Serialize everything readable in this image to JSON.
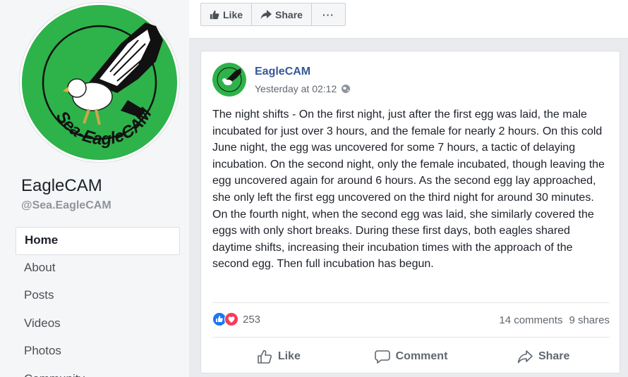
{
  "page": {
    "name": "EagleCAM",
    "handle": "@Sea.EagleCAM",
    "logo_text": "Sea-EagleCAM",
    "logo_color": "#2eb24a"
  },
  "nav": {
    "items": [
      {
        "label": "Home",
        "active": true
      },
      {
        "label": "About"
      },
      {
        "label": "Posts"
      },
      {
        "label": "Videos"
      },
      {
        "label": "Photos"
      },
      {
        "label": "Community"
      }
    ]
  },
  "topbar": {
    "like_label": "Like",
    "like_icon": "thumbs-up-icon",
    "share_label": "Share",
    "share_icon": "share-arrow-icon",
    "more_label": "···"
  },
  "post": {
    "author": "EagleCAM",
    "timestamp": "Yesterday at 02:12",
    "audience_icon": "globe-icon",
    "text_lead": "The night shifts - ",
    "text_body": "On the first night, just after the first egg was laid, the male incubated for just over 3 hours, and the female for nearly 2 hours. On this cold June night, the egg was uncovered for some 7 hours, a tactic of delaying incubation. On the second night, only the female incubated, though leaving the egg uncovered again for around 6 hours. As the second egg lay approached, she only left the first egg uncovered on the third night for around 30 minutes. On the fourth night, when the second egg was laid, she similarly covered the eggs with only short breaks. During these first days, both eagles shared daytime shifts, increasing their incubation times with the approach of the second egg. Then full incubation has begun.",
    "reaction_count": "253",
    "comments": "14 comments",
    "shares": "9 shares",
    "actions": {
      "like": "Like",
      "comment": "Comment",
      "share": "Share"
    }
  },
  "colors": {
    "link": "#365899",
    "like_blue": "#1877f2",
    "love_red": "#f33e58"
  }
}
